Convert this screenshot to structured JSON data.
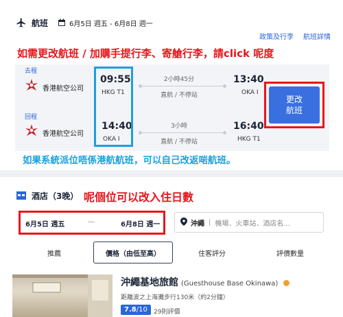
{
  "flight": {
    "title": "航班",
    "dates": "6月5日 週五 - 6月8日 週一",
    "links": [
      "政策及行李",
      "航班詳情"
    ],
    "outbound": {
      "tag": "去程",
      "airline": "香港航空公司",
      "dep_time": "09:55",
      "dep_airport": "HKG T1",
      "duration": "2小時45分",
      "stops": "直航 / 不停站",
      "arr_time": "13:40",
      "arr_airport": "OKA I"
    },
    "inbound": {
      "tag": "回程",
      "airline": "香港航空公司",
      "dep_time": "14:40",
      "dep_airport": "OKA I",
      "duration": "3小時",
      "stops": "直航 / 不停站",
      "arr_time": "16:40",
      "arr_airport": "HKG T1"
    },
    "change_button": [
      "更改",
      "航班"
    ]
  },
  "annotations": {
    "change_flight": "如需更改航班 / 加購手提行李、寄艙行李，請click 呢度",
    "own_flight": "如果系統派位唔係港航航班，可以自己改返啱航班。",
    "dates_hint": "呢個位可以改入住日數"
  },
  "hotel": {
    "title": "酒店（3晚）",
    "checkin": "6月5日 週五",
    "dash": "—",
    "checkout": "6月8日 週一",
    "city": "沖繩",
    "location_placeholder": "機場．火車站．酒店名...",
    "sort_tabs": [
      "推薦",
      "價格（由低至高）",
      "住客評分",
      "評價數量"
    ],
    "result": {
      "name": "沖繩基地旅館",
      "name_en": "(Guesthouse Base Okinawa)",
      "distance": "距離波之上海灘步行130米（約2分鐘）",
      "score": "7.8",
      "score_max": "/10",
      "reviews": "29則評價"
    }
  },
  "colors": {
    "accent": "#2a66d8",
    "annotation_red": "#e8141b",
    "annotation_blue": "#1aa0dc",
    "button": "#3a6fe0"
  }
}
